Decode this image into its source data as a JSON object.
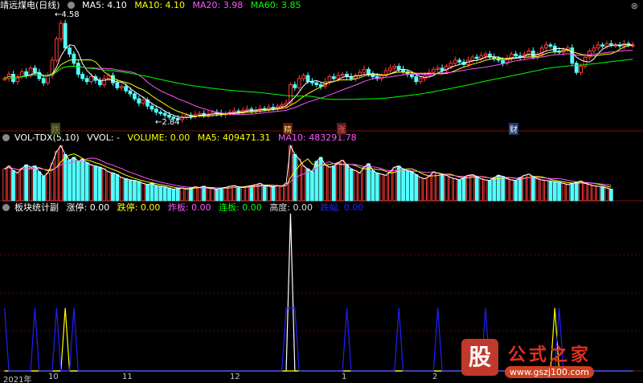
{
  "header": {
    "stock_name": "靖远煤电(日线)",
    "ma_items": [
      {
        "label": "MA5: 4.10",
        "color": "#ffffff"
      },
      {
        "label": "MA10: 4.10",
        "color": "#ffff00"
      },
      {
        "label": "MA20: 3.98",
        "color": "#ff55ff"
      },
      {
        "label": "MA60: 3.85",
        "color": "#00ff00"
      }
    ],
    "high_label": "4.58",
    "low_label": "2.84"
  },
  "signals": [
    {
      "label": "跌",
      "color": "#ff4040",
      "bg": "#1a5a1a"
    },
    {
      "label": "精",
      "color": "#ffdd55",
      "bg": "#5a1a1a"
    },
    {
      "label": "涨",
      "color": "#ff6060",
      "bg": "#5a1a1a"
    },
    {
      "label": "财",
      "color": "#ffffff",
      "bg": "#203a6a"
    }
  ],
  "volume_header": {
    "name": "VOL-TDX(5,10)",
    "items": [
      {
        "label": "VVOL: -",
        "color": "#ffffff"
      },
      {
        "label": "VOLUME: 0.00",
        "color": "#ffff00"
      },
      {
        "label": "MA5: 409471.31",
        "color": "#ffff00"
      },
      {
        "label": "MA10: 483291.78",
        "color": "#ff55ff"
      }
    ]
  },
  "board_header": {
    "name": "板块统计副",
    "items": [
      {
        "label": "涨停: 0.00",
        "color": "#ffffff"
      },
      {
        "label": "跌停: 0.00",
        "color": "#ffff00"
      },
      {
        "label": "炸板: 0.00",
        "color": "#ff55ff"
      },
      {
        "label": "连板: 0.00",
        "color": "#00ff00"
      },
      {
        "label": "高度: 0.00",
        "color": "#dddddd"
      },
      {
        "label": "跌幅: 0.00",
        "color": "#2020ff"
      }
    ]
  },
  "x_axis": [
    "2021年",
    "10",
    "11",
    "12",
    "1",
    "2"
  ],
  "watermark": {
    "logo": "股",
    "title": "公式之家",
    "url": "www.gszj100.com"
  },
  "chart_data": [
    {
      "type": "candlestick",
      "title": "靖远煤电(日线)",
      "annotations": [
        {
          "label": "4.58",
          "kind": "high"
        },
        {
          "label": "2.84",
          "kind": "low"
        }
      ],
      "series_lines": [
        "MA5",
        "MA10",
        "MA20",
        "MA60"
      ],
      "close": [
        3.55,
        3.62,
        3.5,
        3.58,
        3.66,
        3.6,
        3.72,
        3.65,
        3.55,
        3.48,
        3.6,
        3.85,
        4.2,
        4.45,
        4.05,
        3.95,
        3.8,
        3.62,
        3.55,
        3.5,
        3.58,
        3.52,
        3.45,
        3.55,
        3.6,
        3.48,
        3.4,
        3.42,
        3.35,
        3.3,
        3.22,
        3.15,
        3.2,
        3.1,
        3.05,
        3.0,
        2.98,
        2.95,
        2.92,
        2.9,
        2.88,
        2.92,
        2.95,
        2.93,
        2.96,
        2.98,
        2.95,
        2.97,
        3.0,
        2.98,
        2.96,
        2.98,
        3.0,
        3.02,
        3.0,
        3.03,
        3.05,
        3.02,
        3.04,
        3.06,
        3.05,
        3.08,
        3.06,
        3.1,
        3.12,
        3.15,
        3.45,
        3.4,
        3.55,
        3.6,
        3.5,
        3.48,
        3.45,
        3.42,
        3.5,
        3.58,
        3.55,
        3.6,
        3.62,
        3.58,
        3.55,
        3.6,
        3.65,
        3.7,
        3.62,
        3.58,
        3.55,
        3.6,
        3.68,
        3.72,
        3.75,
        3.7,
        3.66,
        3.62,
        3.58,
        3.5,
        3.55,
        3.6,
        3.65,
        3.7,
        3.72,
        3.68,
        3.75,
        3.8,
        3.85,
        3.82,
        3.78,
        3.85,
        3.9,
        3.88,
        3.92,
        3.95,
        3.9,
        3.88,
        3.85,
        3.8,
        3.88,
        3.95,
        3.92,
        3.9,
        3.95,
        4.0,
        3.9,
        3.95,
        4.05,
        4.1,
        4.08,
        4.0,
        3.98,
        4.02,
        4.05,
        3.8,
        3.65,
        3.75,
        3.9,
        4.0,
        4.05,
        4.1,
        4.08,
        4.12,
        4.1,
        4.1,
        4.08,
        4.12,
        4.1,
        4.1
      ]
    },
    {
      "type": "bar",
      "title": "VOL-TDX(5,10)",
      "series_lines": [
        "VVOL",
        "MA5",
        "MA10"
      ],
      "values": [
        55,
        60,
        52,
        48,
        56,
        62,
        58,
        60,
        50,
        42,
        48,
        65,
        85,
        95,
        80,
        70,
        75,
        68,
        72,
        66,
        62,
        60,
        58,
        55,
        50,
        48,
        45,
        40,
        38,
        36,
        35,
        33,
        30,
        28,
        30,
        26,
        25,
        24,
        22,
        20,
        21,
        22,
        20,
        22,
        24,
        23,
        25,
        22,
        21,
        20,
        22,
        23,
        25,
        26,
        24,
        23,
        25,
        26,
        28,
        30,
        26,
        25,
        24,
        26,
        25,
        30,
        95,
        80,
        72,
        60,
        55,
        50,
        68,
        75,
        62,
        58,
        60,
        66,
        70,
        62,
        55,
        52,
        48,
        58,
        64,
        52,
        48,
        46,
        44,
        50,
        58,
        60,
        55,
        52,
        50,
        45,
        40,
        38,
        42,
        50,
        48,
        46,
        44,
        40,
        38,
        36,
        40,
        44,
        45,
        42,
        38,
        36,
        35,
        40,
        44,
        42,
        38,
        36,
        35,
        40,
        44,
        46,
        42,
        38,
        36,
        35,
        34,
        33,
        32,
        30,
        28,
        30,
        32,
        34,
        30,
        28,
        26,
        25,
        24,
        22,
        20
      ]
    },
    {
      "type": "line",
      "title": "板块统计副",
      "series": [
        {
          "name": "涨停",
          "values": [
            0,
            0,
            0,
            0,
            0,
            0,
            0,
            0,
            0,
            0,
            0,
            0,
            0,
            0,
            0,
            0,
            0,
            0,
            0,
            0,
            0,
            0,
            0,
            0,
            0,
            0,
            0,
            0,
            0,
            0,
            0,
            0,
            0,
            0,
            0,
            0,
            0,
            0,
            0,
            0,
            0,
            0,
            0,
            0,
            0,
            0,
            0,
            0,
            0,
            0,
            0,
            0,
            0,
            0,
            0,
            0,
            0,
            0,
            0,
            0,
            0,
            0,
            0,
            0,
            0,
            0,
            5,
            0,
            0,
            0,
            0,
            0,
            0,
            0,
            0,
            0,
            0,
            0,
            0,
            0,
            0,
            0,
            0,
            0,
            0,
            0,
            0,
            0,
            0,
            0,
            0,
            0,
            0,
            0,
            0,
            0,
            0,
            0,
            0,
            0,
            0,
            0,
            0,
            0,
            0,
            0,
            0,
            0,
            0,
            0,
            0,
            0,
            0,
            0,
            0,
            0,
            0,
            0,
            0,
            0,
            0,
            0,
            0,
            0,
            0,
            0,
            0,
            0,
            0,
            0,
            0,
            0,
            0,
            0,
            0,
            0,
            0,
            0,
            0,
            0,
            0,
            0,
            0,
            0,
            0,
            0
          ]
        },
        {
          "name": "跌停",
          "values": [
            0,
            0,
            0,
            0,
            0,
            0,
            0,
            0,
            0,
            0,
            0,
            0,
            0,
            0,
            2,
            0,
            0,
            0,
            0,
            0,
            0,
            0,
            0,
            0,
            0,
            0,
            0,
            0,
            0,
            0,
            0,
            0,
            0,
            0,
            0,
            0,
            0,
            0,
            0,
            0,
            0,
            0,
            0,
            0,
            0,
            0,
            0,
            0,
            0,
            0,
            0,
            0,
            0,
            0,
            0,
            0,
            0,
            0,
            0,
            0,
            0,
            0,
            0,
            0,
            0,
            0,
            0,
            0,
            0,
            0,
            0,
            0,
            0,
            0,
            0,
            0,
            0,
            0,
            0,
            0,
            0,
            0,
            0,
            0,
            0,
            0,
            0,
            0,
            0,
            0,
            0,
            0,
            0,
            0,
            0,
            0,
            0,
            0,
            0,
            0,
            0,
            0,
            0,
            0,
            0,
            0,
            0,
            0,
            0,
            0,
            0,
            0,
            0,
            0,
            0,
            0,
            0,
            0,
            0,
            0,
            0,
            0,
            0,
            0,
            0,
            0,
            0,
            2,
            0,
            0,
            0,
            0,
            0,
            0,
            0,
            0,
            0,
            0,
            0,
            0,
            0,
            0,
            0,
            0,
            0,
            0
          ]
        },
        {
          "name": "跌幅",
          "values": [
            2,
            0,
            0,
            0,
            0,
            0,
            0,
            2,
            0,
            0,
            0,
            0,
            2,
            0,
            0,
            0,
            2,
            0,
            0,
            0,
            0,
            0,
            0,
            0,
            0,
            0,
            0,
            0,
            0,
            0,
            0,
            0,
            0,
            0,
            0,
            0,
            0,
            0,
            0,
            0,
            0,
            0,
            0,
            0,
            0,
            0,
            0,
            0,
            0,
            0,
            0,
            0,
            0,
            0,
            0,
            0,
            0,
            0,
            0,
            0,
            0,
            0,
            0,
            0,
            0,
            2,
            2,
            2,
            0,
            0,
            0,
            0,
            0,
            0,
            0,
            0,
            0,
            0,
            0,
            2,
            0,
            0,
            0,
            0,
            0,
            0,
            0,
            0,
            0,
            0,
            0,
            2,
            0,
            0,
            0,
            0,
            0,
            0,
            0,
            0,
            2,
            0,
            0,
            0,
            0,
            0,
            0,
            0,
            0,
            0,
            0,
            2,
            0,
            0,
            0,
            0,
            0,
            0,
            0,
            0,
            0,
            0,
            0,
            0,
            0,
            0,
            0,
            0,
            2,
            0,
            0,
            0,
            0,
            0,
            0,
            0,
            0,
            0,
            0,
            0,
            0,
            0,
            0,
            0,
            0,
            0
          ]
        }
      ]
    }
  ]
}
